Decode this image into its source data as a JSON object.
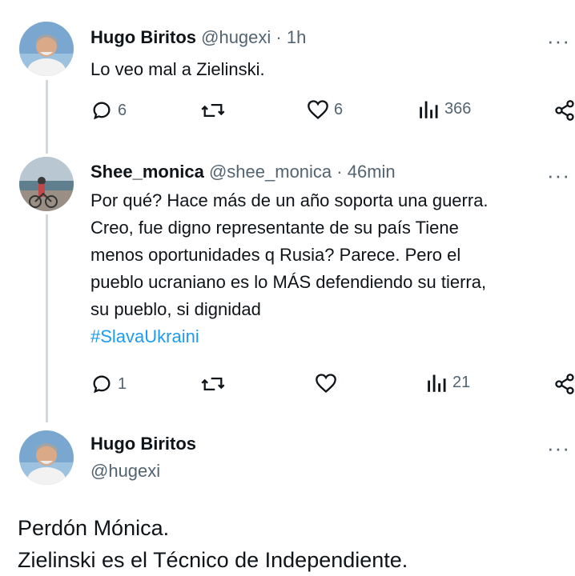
{
  "tweets": [
    {
      "name": "Hugo Biritos",
      "handle": "@hugexi",
      "time": "· 1h",
      "text": "Lo veo mal a Zielinski.",
      "replies": "6",
      "likes": "6",
      "views": "366"
    },
    {
      "name": "Shee_monica",
      "handle": "@shee_monica",
      "time": "· 46min",
      "text_lines": [
        "Por qué? Hace más de un año soporta una guerra.",
        "Creo, fue digno representante de su país Tiene",
        "menos oportunidades q Rusia? Parece. Pero el",
        "pueblo ucraniano es lo MÁS defendiendo su tierra,",
        "su pueblo, si dignidad"
      ],
      "hashtag": "#SlavaUkraini",
      "replies": "1",
      "views": "21"
    },
    {
      "name": "Hugo Biritos",
      "handle": "@hugexi",
      "text_lines": [
        "Perdón Mónica.",
        "Zielinski es el Técnico de Independiente."
      ]
    }
  ],
  "icons": {
    "reply": "reply-icon",
    "retweet": "retweet-icon",
    "like": "like-icon",
    "views": "views-icon",
    "share": "share-icon",
    "more": "more-icon"
  },
  "colors": {
    "hashtag": "#1d9bf0",
    "secondary": "#536471",
    "thread_line": "#cfd9de"
  }
}
